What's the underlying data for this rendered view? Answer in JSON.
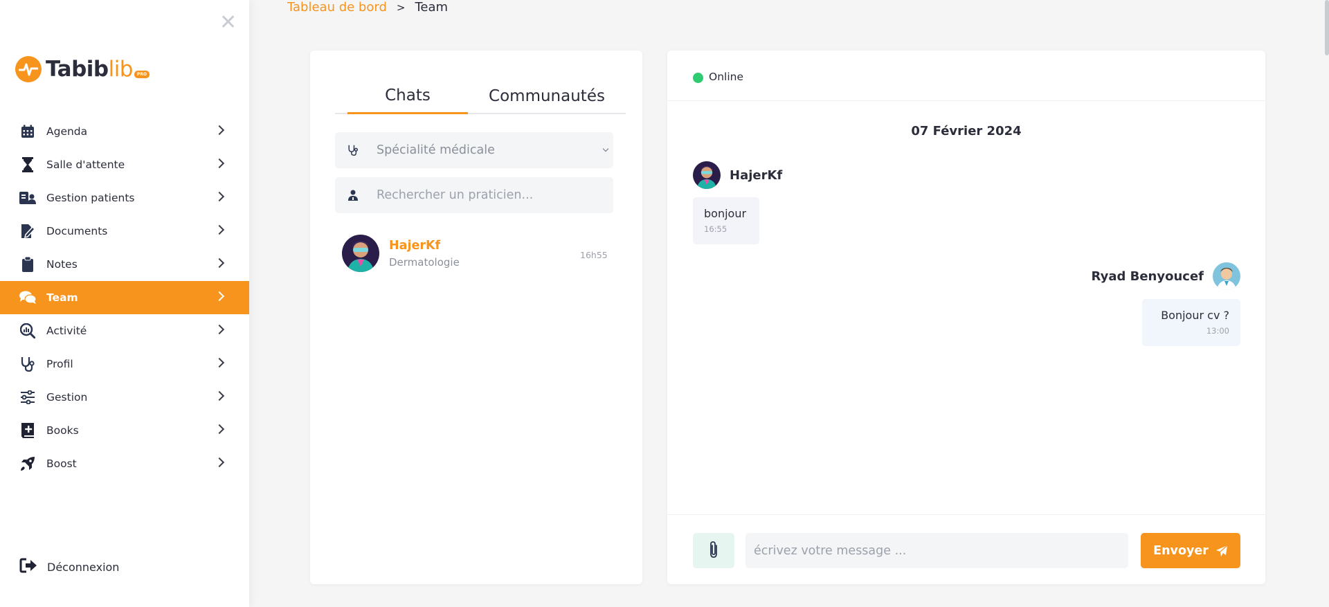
{
  "sidebar": {
    "logo_main": "Tabib",
    "logo_accent": "lib",
    "logo_badge": "PRO",
    "items": [
      {
        "label": "Agenda",
        "icon": "calendar-icon"
      },
      {
        "label": "Salle d'attente",
        "icon": "hourglass-icon"
      },
      {
        "label": "Gestion patients",
        "icon": "patient-card-icon"
      },
      {
        "label": "Documents",
        "icon": "document-edit-icon"
      },
      {
        "label": "Notes",
        "icon": "clipboard-icon"
      },
      {
        "label": "Team",
        "icon": "comments-icon",
        "active": true
      },
      {
        "label": "Activité",
        "icon": "chart-search-icon"
      },
      {
        "label": "Profil",
        "icon": "stethoscope-icon"
      },
      {
        "label": "Gestion",
        "icon": "sliders-icon"
      },
      {
        "label": "Books",
        "icon": "book-plus-icon"
      },
      {
        "label": "Boost",
        "icon": "rocket-icon"
      }
    ],
    "logout_label": "Déconnexion"
  },
  "breadcrumb": {
    "parent": "Tableau de bord",
    "separator": ">",
    "current": "Team"
  },
  "left_panel": {
    "tabs": [
      {
        "label": "Chats",
        "active": true
      },
      {
        "label": "Communautés",
        "active": false
      }
    ],
    "specialty_select": {
      "value": "Spécialité médicale"
    },
    "search": {
      "placeholder": "Rechercher un praticien..."
    },
    "chats": [
      {
        "name": "HajerKf",
        "specialty": "Dermatologie",
        "time": "16h55"
      }
    ]
  },
  "chat": {
    "status": "Online",
    "date": "07 Février 2024",
    "messages": [
      {
        "sender": "HajerKf",
        "text": "bonjour",
        "time": "16:55",
        "direction": "in"
      },
      {
        "sender": "Ryad Benyoucef",
        "text": "Bonjour  cv  ?",
        "time": "13:00",
        "direction": "out"
      }
    ],
    "composer": {
      "placeholder": "écrivez votre message ...",
      "send_label": "Envoyer"
    }
  },
  "colors": {
    "accent": "#f7941d",
    "online": "#2ecc71",
    "attach_bg": "#e7f5f1"
  }
}
